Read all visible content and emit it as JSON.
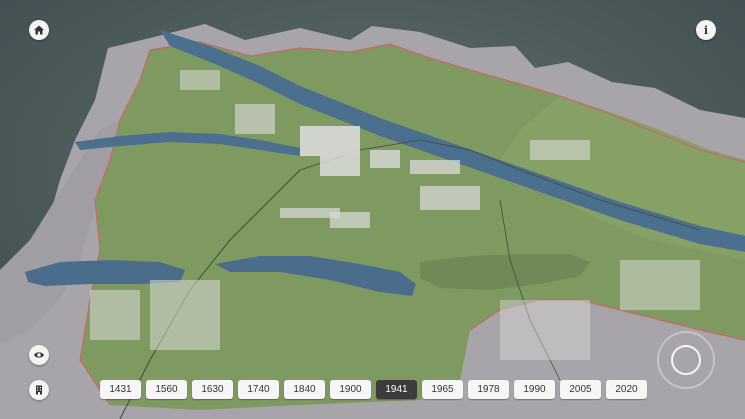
{
  "toolbar": {
    "home_icon": "home-icon",
    "info_icon": "info-icon",
    "info_glyph": "i",
    "view_icon": "eye-icon",
    "building_icon": "building-icon"
  },
  "timeline": {
    "years": [
      "1431",
      "1560",
      "1630",
      "1740",
      "1840",
      "1900",
      "1941",
      "1965",
      "1978",
      "1990",
      "2005",
      "2020"
    ],
    "selected": "1941"
  },
  "colors": {
    "background": "#4d5c5d",
    "terrain_grey": "#a4a2a6",
    "grass": "#7e9860",
    "water": "#4a6d8c",
    "border": "#c9676a",
    "active_year_bg": "#3c3c3c"
  }
}
